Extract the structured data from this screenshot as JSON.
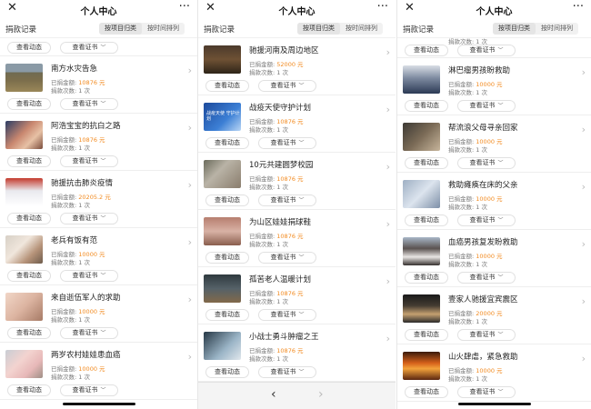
{
  "header": {
    "title": "个人中心",
    "close_icon": "close-icon",
    "more_icon": "more-icon",
    "more_glyph": "···"
  },
  "tabbar": {
    "label": "捐款记录",
    "tab_project": "按项目归类",
    "tab_time": "按时间排列"
  },
  "buttons": {
    "view": "查看动态",
    "cert": "查看证书"
  },
  "amount_label": "已捐金额:",
  "count_label": "捐款次数:",
  "panel1": {
    "items": [
      {
        "name": "南方水灾告急",
        "amount": "10876 元",
        "count": "1 次",
        "thumb": "flood"
      },
      {
        "name": "阿浩宝宝的抗白之路",
        "amount": "10876 元",
        "count": "1 次",
        "thumb": "child"
      },
      {
        "name": "驰援抗击肺炎疫情",
        "amount": "20205.2 元",
        "count": "1 次",
        "thumb": "virus"
      },
      {
        "name": "老兵有饭有范",
        "amount": "10000 元",
        "count": "1 次",
        "thumb": "vet"
      },
      {
        "name": "来自逝伍军人的求助",
        "amount": "10000 元",
        "count": "1 次",
        "thumb": "baby"
      },
      {
        "name": "两岁农村娃娃患血癌",
        "amount": "10000 元",
        "count": "1 次",
        "thumb": "twins"
      }
    ]
  },
  "panel2": {
    "items": [
      {
        "name": "驰援河南及周边地区",
        "amount": "52000 元",
        "count": "1 次",
        "thumb": "henan"
      },
      {
        "name": "战疫天使守护计划",
        "amount": "10876 元",
        "count": "1 次",
        "thumb": "angel",
        "thumb_text": "战疫天使 守护计划"
      },
      {
        "name": "10元共建圆梦校园",
        "amount": "10876 元",
        "count": "1 次",
        "thumb": "school"
      },
      {
        "name": "为山区娃娃捐球鞋",
        "amount": "10876 元",
        "count": "1 次",
        "thumb": "shoes"
      },
      {
        "name": "孤苦老人温暖计划",
        "amount": "10876 元",
        "count": "1 次",
        "thumb": "elder"
      },
      {
        "name": "小战士勇斗肿瘤之王",
        "amount": "10876 元",
        "count": "1 次",
        "thumb": "soldier"
      }
    ]
  },
  "panel3": {
    "top_count": "捐款次数: 1 次",
    "items": [
      {
        "name": "淋巴瘤男孩盼救助",
        "amount": "10000 元",
        "count": "1 次",
        "thumb": "lymph"
      },
      {
        "name": "帮流浪父母寻亲回家",
        "amount": "10000 元",
        "count": "1 次",
        "thumb": "home"
      },
      {
        "name": "救助瘫痪在床的父亲",
        "amount": "10000 元",
        "count": "1 次",
        "thumb": "father"
      },
      {
        "name": "血癌男孩复发盼救助",
        "amount": "10000 元",
        "count": "1 次",
        "thumb": "blood"
      },
      {
        "name": "壹家人驰援宜宾震区",
        "amount": "20000 元",
        "count": "1 次",
        "thumb": "quake"
      },
      {
        "name": "山火肆虐，紧急救助",
        "amount": "10000 元",
        "count": "1 次",
        "thumb": "fire"
      }
    ]
  },
  "toolbar": {
    "back": "‹",
    "forward": "›"
  }
}
